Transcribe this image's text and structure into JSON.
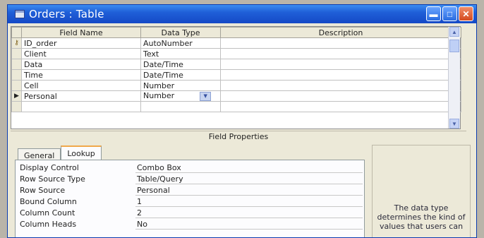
{
  "window": {
    "title": "Orders : Table"
  },
  "grid": {
    "columns": [
      "Field Name",
      "Data Type",
      "Description"
    ],
    "rows": [
      {
        "name": "ID_order",
        "type": "AutoNumber",
        "description": "",
        "key": true,
        "current": false
      },
      {
        "name": "Client",
        "type": "Text",
        "description": "",
        "key": false,
        "current": false
      },
      {
        "name": "Data",
        "type": "Date/Time",
        "description": "",
        "key": false,
        "current": false
      },
      {
        "name": "Time",
        "type": "Date/Time",
        "description": "",
        "key": false,
        "current": false
      },
      {
        "name": "Cell",
        "type": "Number",
        "description": "",
        "key": false,
        "current": false
      },
      {
        "name": "Personal",
        "type": "Number",
        "description": "",
        "key": false,
        "current": true
      }
    ]
  },
  "field_properties": {
    "header": "Field Properties",
    "tabs": [
      "General",
      "Lookup"
    ],
    "active_tab": "Lookup",
    "properties": [
      {
        "label": "Display Control",
        "value": "Combo Box"
      },
      {
        "label": "Row Source Type",
        "value": "Table/Query"
      },
      {
        "label": "Row Source",
        "value": "Personal"
      },
      {
        "label": "Bound Column",
        "value": "1"
      },
      {
        "label": "Column Count",
        "value": "2"
      },
      {
        "label": "Column Heads",
        "value": "No"
      }
    ],
    "help_text": "The data type determines the kind of values that users can"
  },
  "icons": {
    "primary_key": "key-icon",
    "row_selector": "arrow-right-icon",
    "combo": "chevron-down-icon"
  }
}
